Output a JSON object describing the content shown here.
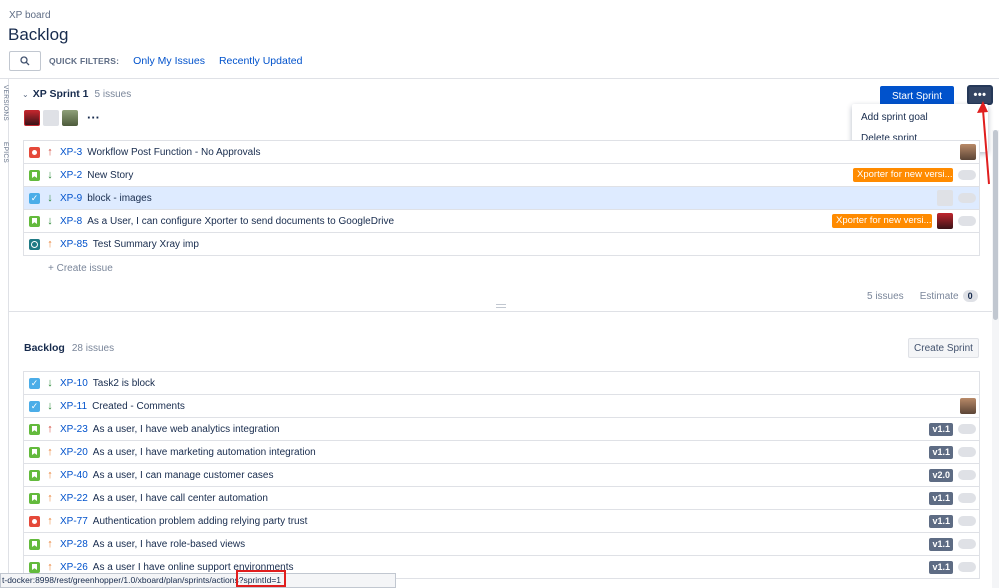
{
  "breadcrumb": "XP board",
  "title": "Backlog",
  "filters": {
    "label": "QUICK FILTERS:",
    "items": [
      "Only My Issues",
      "Recently Updated"
    ]
  },
  "side_tabs": [
    "VERSIONS",
    "EPICS"
  ],
  "sprint": {
    "name": "XP Sprint 1",
    "count": "5 issues",
    "start_label": "Start Sprint",
    "more_label": "•••",
    "menu": [
      "Add sprint goal",
      "Delete sprint"
    ],
    "issues": [
      {
        "type": "bug",
        "priority": "high",
        "key": "XP-3",
        "summary": "Workflow Post Function - No Approvals",
        "epic": "",
        "avatar": "photo"
      },
      {
        "type": "story",
        "priority": "low",
        "key": "XP-2",
        "summary": "New Story",
        "epic": "Xporter for new versi...",
        "avatar": ""
      },
      {
        "type": "task",
        "priority": "low",
        "key": "XP-9",
        "summary": "block - images",
        "epic": "",
        "avatar": "grey"
      },
      {
        "type": "story",
        "priority": "low",
        "key": "XP-8",
        "summary": "As a User, I can configure Xporter to send documents to GoogleDrive",
        "epic": "Xporter for new versi...",
        "avatar": "red"
      },
      {
        "type": "test",
        "priority": "med",
        "key": "XP-85",
        "summary": "Test Summary Xray imp",
        "epic": "",
        "avatar": ""
      }
    ],
    "create_issue": "+   Create issue",
    "footer_count": "5 issues",
    "estimate_label": "Estimate",
    "estimate_value": "0"
  },
  "backlog": {
    "name": "Backlog",
    "count": "28 issues",
    "create_sprint": "Create Sprint",
    "issues": [
      {
        "type": "task",
        "priority": "low",
        "key": "XP-10",
        "summary": "Task2 is block",
        "version": "",
        "avatar": ""
      },
      {
        "type": "task",
        "priority": "low",
        "key": "XP-11",
        "summary": "Created - Comments",
        "version": "",
        "avatar": "photo"
      },
      {
        "type": "story",
        "priority": "high",
        "key": "XP-23",
        "summary": "As a user, I have web analytics integration",
        "version": "v1.1",
        "avatar": ""
      },
      {
        "type": "story",
        "priority": "med",
        "key": "XP-20",
        "summary": "As a user, I have marketing automation integration",
        "version": "v1.1",
        "avatar": ""
      },
      {
        "type": "story",
        "priority": "med",
        "key": "XP-40",
        "summary": "As a user, I can manage customer cases",
        "version": "v2.0",
        "avatar": ""
      },
      {
        "type": "story",
        "priority": "med",
        "key": "XP-22",
        "summary": "As a user, I have call center automation",
        "version": "v1.1",
        "avatar": ""
      },
      {
        "type": "bug",
        "priority": "med",
        "key": "XP-77",
        "summary": "Authentication problem adding relying party trust",
        "version": "v1.1",
        "avatar": ""
      },
      {
        "type": "story",
        "priority": "med",
        "key": "XP-28",
        "summary": "As a user, I have role-based views",
        "version": "v1.1",
        "avatar": ""
      },
      {
        "type": "story",
        "priority": "med",
        "key": "XP-26",
        "summary": "As a user I have online support environments",
        "version": "v1.1",
        "avatar": ""
      }
    ]
  },
  "status_url": "t-docker:8998/rest/greenhopper/1.0/xboard/plan/sprints/actions?sprintId=1",
  "colors": {
    "primary": "#0052cc",
    "annotation": "#e01e1e",
    "epic": "#ff8b00"
  }
}
